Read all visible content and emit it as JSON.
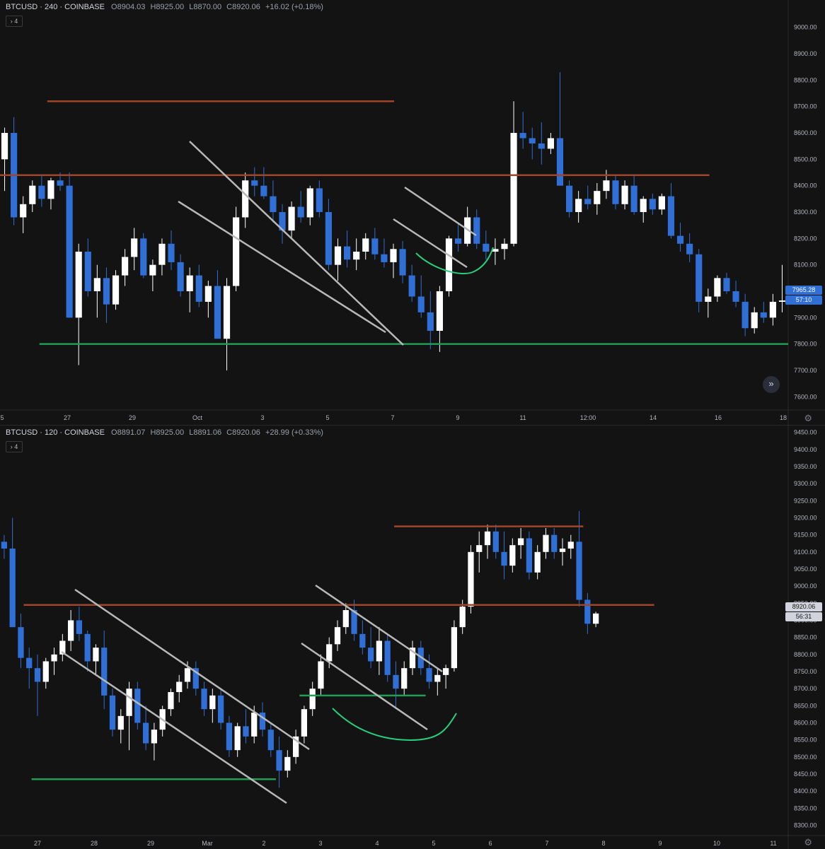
{
  "panels": [
    {
      "legend": {
        "symbol": "BTCUSD · 240 · COINBASE",
        "open": "O8904.03",
        "high": "H8925.00",
        "low": "L8870.00",
        "close": "C8920.06",
        "change": "+16.02 (+0.18%)"
      },
      "indicator_count": "4",
      "last_price_label": "7965.28",
      "countdown_label": "57:10",
      "colors": {
        "up": "#ffffff",
        "down": "#2f6fd6",
        "resistance": "#a0442a",
        "support": "#1f9d55",
        "channel": "#b8b8b8",
        "curve": "#26d07c"
      },
      "chart_data": {
        "type": "candlestick",
        "interval": "240",
        "exchange": "COINBASE",
        "ylim": [
          7550,
          9050
        ],
        "y_ticks": [
          "9000.00",
          "8900.00",
          "8800.00",
          "8700.00",
          "8600.00",
          "8500.00",
          "8400.00",
          "8300.00",
          "8200.00",
          "8100.00",
          "8000.00",
          "7900.00",
          "7800.00",
          "7700.00",
          "7600.00"
        ],
        "x_ticks": [
          "5",
          "27",
          "29",
          "Oct",
          "3",
          "5",
          "7",
          "9",
          "11",
          "12:00",
          "14",
          "16",
          "18",
          "12:00"
        ],
        "candles": [
          [
            8500,
            8620,
            8380,
            8600
          ],
          [
            8600,
            8660,
            8250,
            8280
          ],
          [
            8280,
            8360,
            8220,
            8330
          ],
          [
            8330,
            8420,
            8300,
            8400
          ],
          [
            8400,
            8440,
            8320,
            8350
          ],
          [
            8350,
            8430,
            8310,
            8420
          ],
          [
            8420,
            8450,
            8380,
            8400
          ],
          [
            8400,
            8450,
            7900,
            7900
          ],
          [
            7900,
            8180,
            7720,
            8150
          ],
          [
            8150,
            8200,
            7980,
            8000
          ],
          [
            8000,
            8100,
            7900,
            8050
          ],
          [
            8050,
            8090,
            7880,
            7950
          ],
          [
            7950,
            8080,
            7930,
            8060
          ],
          [
            8060,
            8160,
            8020,
            8130
          ],
          [
            8130,
            8240,
            8080,
            8200
          ],
          [
            8200,
            8220,
            8050,
            8060
          ],
          [
            8060,
            8120,
            8000,
            8100
          ],
          [
            8100,
            8200,
            8060,
            8180
          ],
          [
            8180,
            8230,
            8080,
            8110
          ],
          [
            8110,
            8140,
            7980,
            8000
          ],
          [
            8000,
            8090,
            7920,
            8060
          ],
          [
            8060,
            8100,
            7940,
            7960
          ],
          [
            7960,
            8040,
            7900,
            8020
          ],
          [
            8020,
            8080,
            7820,
            7820
          ],
          [
            7820,
            8050,
            7700,
            8020
          ],
          [
            8020,
            8320,
            8000,
            8280
          ],
          [
            8280,
            8450,
            8240,
            8420
          ],
          [
            8420,
            8470,
            8360,
            8400
          ],
          [
            8400,
            8470,
            8350,
            8360
          ],
          [
            8360,
            8420,
            8260,
            8300
          ],
          [
            8300,
            8330,
            8180,
            8230
          ],
          [
            8230,
            8340,
            8200,
            8320
          ],
          [
            8320,
            8380,
            8260,
            8280
          ],
          [
            8280,
            8400,
            8250,
            8390
          ],
          [
            8390,
            8420,
            8280,
            8300
          ],
          [
            8300,
            8350,
            8080,
            8100
          ],
          [
            8100,
            8200,
            8040,
            8170
          ],
          [
            8170,
            8230,
            8090,
            8120
          ],
          [
            8120,
            8200,
            8080,
            8150
          ],
          [
            8150,
            8220,
            8120,
            8200
          ],
          [
            8200,
            8240,
            8120,
            8140
          ],
          [
            8140,
            8200,
            8090,
            8110
          ],
          [
            8110,
            8180,
            8050,
            8160
          ],
          [
            8160,
            8190,
            8030,
            8060
          ],
          [
            8060,
            8100,
            7960,
            7980
          ],
          [
            7980,
            8060,
            7900,
            7920
          ],
          [
            7920,
            8000,
            7780,
            7850
          ],
          [
            7850,
            8020,
            7770,
            8000
          ],
          [
            8000,
            8210,
            7980,
            8200
          ],
          [
            8200,
            8260,
            8150,
            8180
          ],
          [
            8180,
            8320,
            8170,
            8280
          ],
          [
            8280,
            8310,
            8160,
            8180
          ],
          [
            8180,
            8230,
            8120,
            8150
          ],
          [
            8150,
            8200,
            8100,
            8160
          ],
          [
            8160,
            8200,
            8120,
            8180
          ],
          [
            8180,
            8720,
            8170,
            8600
          ],
          [
            8600,
            8680,
            8540,
            8580
          ],
          [
            8580,
            8620,
            8500,
            8560
          ],
          [
            8560,
            8640,
            8480,
            8540
          ],
          [
            8540,
            8600,
            8520,
            8580
          ],
          [
            8580,
            8830,
            8400,
            8400
          ],
          [
            8400,
            8420,
            8280,
            8300
          ],
          [
            8300,
            8380,
            8260,
            8350
          ],
          [
            8350,
            8400,
            8310,
            8330
          ],
          [
            8330,
            8410,
            8290,
            8380
          ],
          [
            8380,
            8460,
            8350,
            8420
          ],
          [
            8420,
            8440,
            8310,
            8330
          ],
          [
            8330,
            8420,
            8310,
            8400
          ],
          [
            8400,
            8440,
            8290,
            8300
          ],
          [
            8300,
            8360,
            8260,
            8350
          ],
          [
            8350,
            8370,
            8290,
            8310
          ],
          [
            8310,
            8370,
            8290,
            8360
          ],
          [
            8360,
            8410,
            8200,
            8210
          ],
          [
            8210,
            8260,
            8150,
            8180
          ],
          [
            8180,
            8220,
            8110,
            8140
          ],
          [
            8140,
            8160,
            7920,
            7960
          ],
          [
            7960,
            8010,
            7900,
            7980
          ],
          [
            7980,
            8060,
            7960,
            8050
          ],
          [
            8050,
            8070,
            7990,
            8000
          ],
          [
            8000,
            8040,
            7940,
            7960
          ],
          [
            7960,
            7990,
            7830,
            7860
          ],
          [
            7860,
            7940,
            7840,
            7920
          ],
          [
            7920,
            7960,
            7880,
            7900
          ],
          [
            7900,
            7990,
            7870,
            7960
          ],
          [
            7960,
            8100,
            7920,
            7965
          ]
        ],
        "lines": [
          {
            "kind": "resistance",
            "from": [
              0.06,
              8720
            ],
            "to": [
              0.5,
              8720
            ]
          },
          {
            "kind": "resistance",
            "from": [
              0.0,
              8440
            ],
            "to": [
              0.9,
              8440
            ]
          },
          {
            "kind": "support",
            "from": [
              0.05,
              7800
            ],
            "to": [
              1.0,
              7800
            ]
          }
        ]
      }
    },
    {
      "legend": {
        "symbol": "BTCUSD · 120 · COINBASE",
        "open": "O8891.07",
        "high": "H8925.00",
        "low": "L8891.06",
        "close": "C8920.06",
        "change": "+28.99 (+0.33%)"
      },
      "indicator_count": "4",
      "last_price_label": "8920.06",
      "countdown_label": "56:31",
      "colors": {
        "up": "#ffffff",
        "down": "#2f6fd6",
        "resistance": "#a0442a",
        "support": "#1f9d55",
        "channel": "#b8b8b8",
        "curve": "#26d07c"
      },
      "chart_data": {
        "type": "candlestick",
        "interval": "120",
        "exchange": "COINBASE",
        "ylim": [
          8270,
          9470
        ],
        "y_ticks": [
          "9450.00",
          "9400.00",
          "9350.00",
          "9300.00",
          "9250.00",
          "9200.00",
          "9150.00",
          "9100.00",
          "9050.00",
          "9000.00",
          "8950.00",
          "8900.00",
          "8850.00",
          "8800.00",
          "8750.00",
          "8700.00",
          "8650.00",
          "8600.00",
          "8550.00",
          "8500.00",
          "8450.00",
          "8400.00",
          "8350.00",
          "8300.00"
        ],
        "x_ticks": [
          "27",
          "28",
          "29",
          "Mar",
          "2",
          "3",
          "4",
          "5",
          "6",
          "7",
          "8",
          "9",
          "10",
          "11"
        ],
        "candles": [
          [
            9130,
            9150,
            9080,
            9110
          ],
          [
            9110,
            9200,
            9040,
            8880
          ],
          [
            8880,
            8920,
            8760,
            8790
          ],
          [
            8790,
            8820,
            8700,
            8760
          ],
          [
            8760,
            8800,
            8620,
            8720
          ],
          [
            8720,
            8790,
            8700,
            8780
          ],
          [
            8780,
            8820,
            8740,
            8800
          ],
          [
            8800,
            8860,
            8780,
            8840
          ],
          [
            8840,
            8930,
            8810,
            8900
          ],
          [
            8900,
            8940,
            8840,
            8860
          ],
          [
            8860,
            8870,
            8750,
            8780
          ],
          [
            8780,
            8830,
            8740,
            8820
          ],
          [
            8820,
            8870,
            8640,
            8680
          ],
          [
            8680,
            8700,
            8560,
            8580
          ],
          [
            8580,
            8640,
            8540,
            8620
          ],
          [
            8620,
            8720,
            8520,
            8700
          ],
          [
            8700,
            8720,
            8580,
            8600
          ],
          [
            8600,
            8650,
            8520,
            8540
          ],
          [
            8540,
            8600,
            8490,
            8580
          ],
          [
            8580,
            8650,
            8560,
            8640
          ],
          [
            8640,
            8700,
            8620,
            8690
          ],
          [
            8690,
            8740,
            8660,
            8720
          ],
          [
            8720,
            8780,
            8700,
            8760
          ],
          [
            8760,
            8780,
            8680,
            8700
          ],
          [
            8700,
            8720,
            8620,
            8640
          ],
          [
            8640,
            8700,
            8600,
            8680
          ],
          [
            8680,
            8700,
            8580,
            8600
          ],
          [
            8600,
            8620,
            8500,
            8520
          ],
          [
            8520,
            8600,
            8500,
            8590
          ],
          [
            8590,
            8640,
            8540,
            8560
          ],
          [
            8560,
            8650,
            8540,
            8630
          ],
          [
            8630,
            8660,
            8560,
            8580
          ],
          [
            8580,
            8600,
            8500,
            8520
          ],
          [
            8520,
            8560,
            8410,
            8460
          ],
          [
            8460,
            8520,
            8440,
            8500
          ],
          [
            8500,
            8580,
            8480,
            8560
          ],
          [
            8560,
            8650,
            8540,
            8640
          ],
          [
            8640,
            8720,
            8620,
            8700
          ],
          [
            8700,
            8800,
            8680,
            8780
          ],
          [
            8780,
            8850,
            8760,
            8830
          ],
          [
            8830,
            8900,
            8810,
            8880
          ],
          [
            8880,
            8950,
            8860,
            8930
          ],
          [
            8930,
            8960,
            8840,
            8860
          ],
          [
            8860,
            8900,
            8800,
            8820
          ],
          [
            8820,
            8880,
            8760,
            8780
          ],
          [
            8780,
            8880,
            8740,
            8840
          ],
          [
            8840,
            8860,
            8720,
            8740
          ],
          [
            8740,
            8780,
            8640,
            8700
          ],
          [
            8700,
            8780,
            8680,
            8760
          ],
          [
            8760,
            8840,
            8740,
            8820
          ],
          [
            8820,
            8840,
            8740,
            8760
          ],
          [
            8760,
            8800,
            8700,
            8720
          ],
          [
            8720,
            8760,
            8680,
            8740
          ],
          [
            8740,
            8770,
            8700,
            8760
          ],
          [
            8760,
            8900,
            8750,
            8880
          ],
          [
            8880,
            8960,
            8860,
            8940
          ],
          [
            8940,
            9120,
            8920,
            9100
          ],
          [
            9100,
            9160,
            9040,
            9120
          ],
          [
            9120,
            9180,
            9080,
            9160
          ],
          [
            9160,
            9180,
            9080,
            9100
          ],
          [
            9100,
            9160,
            9020,
            9060
          ],
          [
            9060,
            9140,
            9040,
            9120
          ],
          [
            9120,
            9170,
            9080,
            9140
          ],
          [
            9140,
            9160,
            9020,
            9040
          ],
          [
            9040,
            9120,
            9020,
            9100
          ],
          [
            9100,
            9170,
            9080,
            9150
          ],
          [
            9150,
            9170,
            9080,
            9100
          ],
          [
            9100,
            9140,
            9060,
            9110
          ],
          [
            9110,
            9150,
            9080,
            9130
          ],
          [
            9130,
            9220,
            8940,
            8960
          ],
          [
            8960,
            8980,
            8860,
            8890
          ],
          [
            8890,
            8925,
            8880,
            8920
          ]
        ],
        "lines": [
          {
            "kind": "resistance",
            "from": [
              0.5,
              9175
            ],
            "to": [
              0.74,
              9175
            ]
          },
          {
            "kind": "resistance",
            "from": [
              0.03,
              8945
            ],
            "to": [
              0.83,
              8945
            ]
          },
          {
            "kind": "support",
            "from": [
              0.04,
              8435
            ],
            "to": [
              0.35,
              8435
            ]
          },
          {
            "kind": "support",
            "from": [
              0.38,
              8680
            ],
            "to": [
              0.54,
              8680
            ]
          }
        ]
      }
    }
  ]
}
